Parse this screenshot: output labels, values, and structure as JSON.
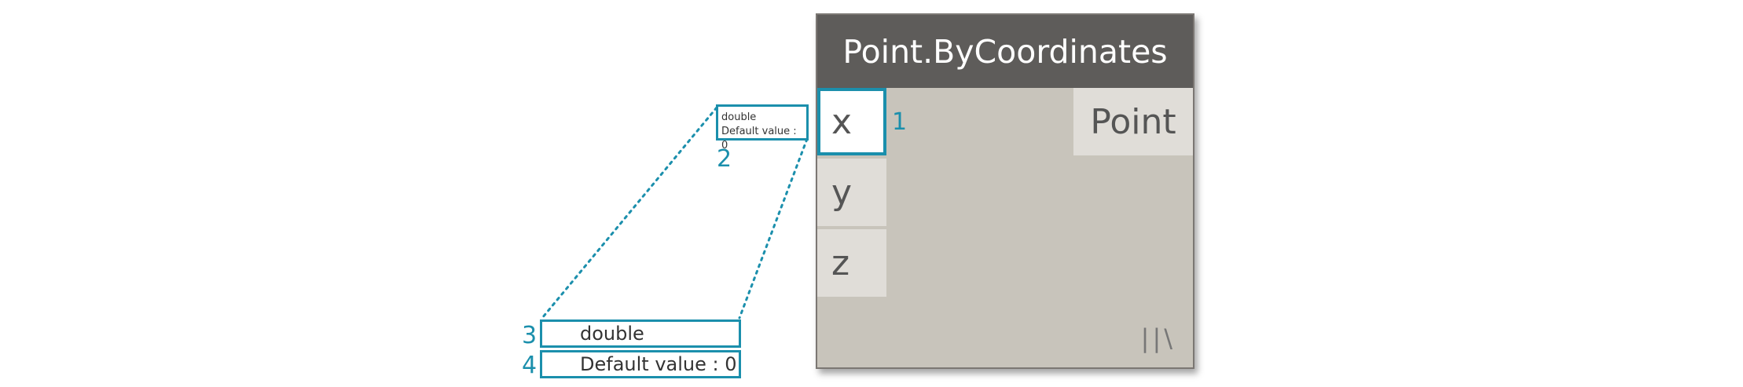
{
  "node": {
    "title": "Point.ByCoordinates",
    "inputs": [
      "x",
      "y",
      "z"
    ],
    "output": "Point",
    "lacing": "||\\"
  },
  "tooltip": {
    "type": "double",
    "default": "Default value : 0"
  },
  "callouts": [
    "1",
    "2",
    "3",
    "4"
  ],
  "zoom": {
    "type": "double",
    "default": "Default value : 0"
  },
  "colors": {
    "accent": "#1b8fac",
    "header": "#5e5c5a",
    "body": "#c8c4bb",
    "port": "#e0ddd8"
  }
}
